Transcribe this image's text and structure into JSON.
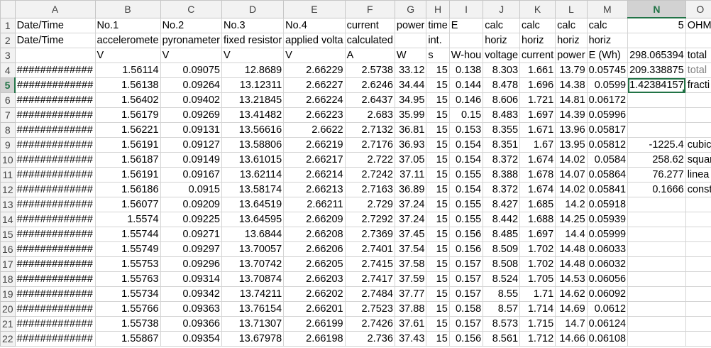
{
  "columns": [
    "A",
    "B",
    "C",
    "D",
    "E",
    "F",
    "G",
    "H",
    "I",
    "J",
    "K",
    "L",
    "M",
    "N",
    "O"
  ],
  "selected_col": "N",
  "selected_row": 5,
  "rows": [
    {
      "r": "1",
      "cells": [
        [
          "Date/Time",
          "t"
        ],
        [
          "No.1",
          "t"
        ],
        [
          "No.2",
          "t"
        ],
        [
          "No.3",
          "t"
        ],
        [
          "No.4",
          "t"
        ],
        [
          "current",
          "t"
        ],
        [
          "power",
          "t"
        ],
        [
          "time",
          "t"
        ],
        [
          "E",
          "t"
        ],
        [
          "calc",
          "t"
        ],
        [
          "calc",
          "t"
        ],
        [
          "calc",
          "t"
        ],
        [
          "calc",
          "t"
        ],
        [
          "5",
          "n"
        ],
        [
          "OHM",
          "t"
        ]
      ]
    },
    {
      "r": "2",
      "cells": [
        [
          "Date/Time",
          "t"
        ],
        [
          "acceleromete",
          "t"
        ],
        [
          "pyronameter",
          "t"
        ],
        [
          "fixed resistor",
          "t"
        ],
        [
          "applied volta",
          "t"
        ],
        [
          "calculated",
          "t"
        ],
        [
          "",
          "t"
        ],
        [
          "int.",
          "t"
        ],
        [
          "",
          "t"
        ],
        [
          "horiz",
          "t"
        ],
        [
          "horiz",
          "t"
        ],
        [
          "horiz",
          "t"
        ],
        [
          "horiz",
          "t"
        ],
        [
          "",
          "t"
        ],
        [
          "",
          "t"
        ]
      ]
    },
    {
      "r": "3",
      "cells": [
        [
          "",
          "t"
        ],
        [
          "V",
          "t"
        ],
        [
          "V",
          "t"
        ],
        [
          "V",
          "t"
        ],
        [
          "V",
          "t"
        ],
        [
          "A",
          "t"
        ],
        [
          "W",
          "t"
        ],
        [
          "s",
          "t"
        ],
        [
          "W-hou",
          "t"
        ],
        [
          "voltage",
          "t"
        ],
        [
          "current",
          "t"
        ],
        [
          "power",
          "t"
        ],
        [
          "E (Wh)",
          "t"
        ],
        [
          "298.065394",
          "n"
        ],
        [
          "total",
          "t"
        ]
      ]
    },
    {
      "r": "4",
      "cells": [
        [
          "#############",
          "h"
        ],
        [
          "1.56114",
          "n"
        ],
        [
          "0.09075",
          "n"
        ],
        [
          "12.8689",
          "n"
        ],
        [
          "2.66229",
          "n"
        ],
        [
          "2.5738",
          "n"
        ],
        [
          "33.12",
          "n"
        ],
        [
          "15",
          "n"
        ],
        [
          "0.138",
          "n"
        ],
        [
          "8.303",
          "n"
        ],
        [
          "1.661",
          "n"
        ],
        [
          "13.79",
          "n"
        ],
        [
          "0.05745",
          "n"
        ],
        [
          "209.338875",
          "n"
        ],
        [
          "total",
          "g"
        ]
      ]
    },
    {
      "r": "5",
      "cells": [
        [
          "#############",
          "h"
        ],
        [
          "1.56138",
          "n"
        ],
        [
          "0.09264",
          "n"
        ],
        [
          "13.12311",
          "n"
        ],
        [
          "2.66227",
          "n"
        ],
        [
          "2.6246",
          "n"
        ],
        [
          "34.44",
          "n"
        ],
        [
          "15",
          "n"
        ],
        [
          "0.144",
          "n"
        ],
        [
          "8.478",
          "n"
        ],
        [
          "1.696",
          "n"
        ],
        [
          "14.38",
          "n"
        ],
        [
          "0.0599",
          "n"
        ],
        [
          "1.42384157",
          "n"
        ],
        [
          "fracti",
          "t"
        ]
      ]
    },
    {
      "r": "6",
      "cells": [
        [
          "#############",
          "h"
        ],
        [
          "1.56402",
          "n"
        ],
        [
          "0.09402",
          "n"
        ],
        [
          "13.21845",
          "n"
        ],
        [
          "2.66224",
          "n"
        ],
        [
          "2.6437",
          "n"
        ],
        [
          "34.95",
          "n"
        ],
        [
          "15",
          "n"
        ],
        [
          "0.146",
          "n"
        ],
        [
          "8.606",
          "n"
        ],
        [
          "1.721",
          "n"
        ],
        [
          "14.81",
          "n"
        ],
        [
          "0.06172",
          "n"
        ],
        [
          "",
          "t"
        ],
        [
          "",
          "t"
        ]
      ]
    },
    {
      "r": "7",
      "cells": [
        [
          "#############",
          "h"
        ],
        [
          "1.56179",
          "n"
        ],
        [
          "0.09269",
          "n"
        ],
        [
          "13.41482",
          "n"
        ],
        [
          "2.66223",
          "n"
        ],
        [
          "2.683",
          "n"
        ],
        [
          "35.99",
          "n"
        ],
        [
          "15",
          "n"
        ],
        [
          "0.15",
          "n"
        ],
        [
          "8.483",
          "n"
        ],
        [
          "1.697",
          "n"
        ],
        [
          "14.39",
          "n"
        ],
        [
          "0.05996",
          "n"
        ],
        [
          "",
          "t"
        ],
        [
          "",
          "t"
        ]
      ]
    },
    {
      "r": "8",
      "cells": [
        [
          "#############",
          "h"
        ],
        [
          "1.56221",
          "n"
        ],
        [
          "0.09131",
          "n"
        ],
        [
          "13.56616",
          "n"
        ],
        [
          "2.6622",
          "n"
        ],
        [
          "2.7132",
          "n"
        ],
        [
          "36.81",
          "n"
        ],
        [
          "15",
          "n"
        ],
        [
          "0.153",
          "n"
        ],
        [
          "8.355",
          "n"
        ],
        [
          "1.671",
          "n"
        ],
        [
          "13.96",
          "n"
        ],
        [
          "0.05817",
          "n"
        ],
        [
          "",
          "t"
        ],
        [
          "",
          "t"
        ]
      ]
    },
    {
      "r": "9",
      "cells": [
        [
          "#############",
          "h"
        ],
        [
          "1.56191",
          "n"
        ],
        [
          "0.09127",
          "n"
        ],
        [
          "13.58806",
          "n"
        ],
        [
          "2.66219",
          "n"
        ],
        [
          "2.7176",
          "n"
        ],
        [
          "36.93",
          "n"
        ],
        [
          "15",
          "n"
        ],
        [
          "0.154",
          "n"
        ],
        [
          "8.351",
          "n"
        ],
        [
          "1.67",
          "n"
        ],
        [
          "13.95",
          "n"
        ],
        [
          "0.05812",
          "n"
        ],
        [
          "-1225.4",
          "n"
        ],
        [
          "cubic",
          "t"
        ]
      ]
    },
    {
      "r": "10",
      "cells": [
        [
          "#############",
          "h"
        ],
        [
          "1.56187",
          "n"
        ],
        [
          "0.09149",
          "n"
        ],
        [
          "13.61015",
          "n"
        ],
        [
          "2.66217",
          "n"
        ],
        [
          "2.722",
          "n"
        ],
        [
          "37.05",
          "n"
        ],
        [
          "15",
          "n"
        ],
        [
          "0.154",
          "n"
        ],
        [
          "8.372",
          "n"
        ],
        [
          "1.674",
          "n"
        ],
        [
          "14.02",
          "n"
        ],
        [
          "0.0584",
          "n"
        ],
        [
          "258.62",
          "n"
        ],
        [
          "squar",
          "t"
        ]
      ]
    },
    {
      "r": "11",
      "cells": [
        [
          "#############",
          "h"
        ],
        [
          "1.56191",
          "n"
        ],
        [
          "0.09167",
          "n"
        ],
        [
          "13.62114",
          "n"
        ],
        [
          "2.66214",
          "n"
        ],
        [
          "2.7242",
          "n"
        ],
        [
          "37.11",
          "n"
        ],
        [
          "15",
          "n"
        ],
        [
          "0.155",
          "n"
        ],
        [
          "8.388",
          "n"
        ],
        [
          "1.678",
          "n"
        ],
        [
          "14.07",
          "n"
        ],
        [
          "0.05864",
          "n"
        ],
        [
          "76.277",
          "n"
        ],
        [
          "linea",
          "t"
        ]
      ]
    },
    {
      "r": "12",
      "cells": [
        [
          "#############",
          "h"
        ],
        [
          "1.56186",
          "n"
        ],
        [
          "0.0915",
          "n"
        ],
        [
          "13.58174",
          "n"
        ],
        [
          "2.66213",
          "n"
        ],
        [
          "2.7163",
          "n"
        ],
        [
          "36.89",
          "n"
        ],
        [
          "15",
          "n"
        ],
        [
          "0.154",
          "n"
        ],
        [
          "8.372",
          "n"
        ],
        [
          "1.674",
          "n"
        ],
        [
          "14.02",
          "n"
        ],
        [
          "0.05841",
          "n"
        ],
        [
          "0.1666",
          "n"
        ],
        [
          "const",
          "t"
        ]
      ]
    },
    {
      "r": "13",
      "cells": [
        [
          "#############",
          "h"
        ],
        [
          "1.56077",
          "n"
        ],
        [
          "0.09209",
          "n"
        ],
        [
          "13.64519",
          "n"
        ],
        [
          "2.66211",
          "n"
        ],
        [
          "2.729",
          "n"
        ],
        [
          "37.24",
          "n"
        ],
        [
          "15",
          "n"
        ],
        [
          "0.155",
          "n"
        ],
        [
          "8.427",
          "n"
        ],
        [
          "1.685",
          "n"
        ],
        [
          "14.2",
          "n"
        ],
        [
          "0.05918",
          "n"
        ],
        [
          "",
          "t"
        ],
        [
          "",
          "t"
        ]
      ]
    },
    {
      "r": "14",
      "cells": [
        [
          "#############",
          "h"
        ],
        [
          "1.5574",
          "n"
        ],
        [
          "0.09225",
          "n"
        ],
        [
          "13.64595",
          "n"
        ],
        [
          "2.66209",
          "n"
        ],
        [
          "2.7292",
          "n"
        ],
        [
          "37.24",
          "n"
        ],
        [
          "15",
          "n"
        ],
        [
          "0.155",
          "n"
        ],
        [
          "8.442",
          "n"
        ],
        [
          "1.688",
          "n"
        ],
        [
          "14.25",
          "n"
        ],
        [
          "0.05939",
          "n"
        ],
        [
          "",
          "t"
        ],
        [
          "",
          "t"
        ]
      ]
    },
    {
      "r": "15",
      "cells": [
        [
          "#############",
          "h"
        ],
        [
          "1.55744",
          "n"
        ],
        [
          "0.09271",
          "n"
        ],
        [
          "13.6844",
          "n"
        ],
        [
          "2.66208",
          "n"
        ],
        [
          "2.7369",
          "n"
        ],
        [
          "37.45",
          "n"
        ],
        [
          "15",
          "n"
        ],
        [
          "0.156",
          "n"
        ],
        [
          "8.485",
          "n"
        ],
        [
          "1.697",
          "n"
        ],
        [
          "14.4",
          "n"
        ],
        [
          "0.05999",
          "n"
        ],
        [
          "",
          "t"
        ],
        [
          "",
          "t"
        ]
      ]
    },
    {
      "r": "16",
      "cells": [
        [
          "#############",
          "h"
        ],
        [
          "1.55749",
          "n"
        ],
        [
          "0.09297",
          "n"
        ],
        [
          "13.70057",
          "n"
        ],
        [
          "2.66206",
          "n"
        ],
        [
          "2.7401",
          "n"
        ],
        [
          "37.54",
          "n"
        ],
        [
          "15",
          "n"
        ],
        [
          "0.156",
          "n"
        ],
        [
          "8.509",
          "n"
        ],
        [
          "1.702",
          "n"
        ],
        [
          "14.48",
          "n"
        ],
        [
          "0.06033",
          "n"
        ],
        [
          "",
          "t"
        ],
        [
          "",
          "t"
        ]
      ]
    },
    {
      "r": "17",
      "cells": [
        [
          "#############",
          "h"
        ],
        [
          "1.55753",
          "n"
        ],
        [
          "0.09296",
          "n"
        ],
        [
          "13.70742",
          "n"
        ],
        [
          "2.66205",
          "n"
        ],
        [
          "2.7415",
          "n"
        ],
        [
          "37.58",
          "n"
        ],
        [
          "15",
          "n"
        ],
        [
          "0.157",
          "n"
        ],
        [
          "8.508",
          "n"
        ],
        [
          "1.702",
          "n"
        ],
        [
          "14.48",
          "n"
        ],
        [
          "0.06032",
          "n"
        ],
        [
          "",
          "t"
        ],
        [
          "",
          "t"
        ]
      ]
    },
    {
      "r": "18",
      "cells": [
        [
          "#############",
          "h"
        ],
        [
          "1.55763",
          "n"
        ],
        [
          "0.09314",
          "n"
        ],
        [
          "13.70874",
          "n"
        ],
        [
          "2.66203",
          "n"
        ],
        [
          "2.7417",
          "n"
        ],
        [
          "37.59",
          "n"
        ],
        [
          "15",
          "n"
        ],
        [
          "0.157",
          "n"
        ],
        [
          "8.524",
          "n"
        ],
        [
          "1.705",
          "n"
        ],
        [
          "14.53",
          "n"
        ],
        [
          "0.06056",
          "n"
        ],
        [
          "",
          "t"
        ],
        [
          "",
          "t"
        ]
      ]
    },
    {
      "r": "19",
      "cells": [
        [
          "#############",
          "h"
        ],
        [
          "1.55734",
          "n"
        ],
        [
          "0.09342",
          "n"
        ],
        [
          "13.74211",
          "n"
        ],
        [
          "2.66202",
          "n"
        ],
        [
          "2.7484",
          "n"
        ],
        [
          "37.77",
          "n"
        ],
        [
          "15",
          "n"
        ],
        [
          "0.157",
          "n"
        ],
        [
          "8.55",
          "n"
        ],
        [
          "1.71",
          "n"
        ],
        [
          "14.62",
          "n"
        ],
        [
          "0.06092",
          "n"
        ],
        [
          "",
          "t"
        ],
        [
          "",
          "t"
        ]
      ]
    },
    {
      "r": "20",
      "cells": [
        [
          "#############",
          "h"
        ],
        [
          "1.55766",
          "n"
        ],
        [
          "0.09363",
          "n"
        ],
        [
          "13.76154",
          "n"
        ],
        [
          "2.66201",
          "n"
        ],
        [
          "2.7523",
          "n"
        ],
        [
          "37.88",
          "n"
        ],
        [
          "15",
          "n"
        ],
        [
          "0.158",
          "n"
        ],
        [
          "8.57",
          "n"
        ],
        [
          "1.714",
          "n"
        ],
        [
          "14.69",
          "n"
        ],
        [
          "0.0612",
          "n"
        ],
        [
          "",
          "t"
        ],
        [
          "",
          "t"
        ]
      ]
    },
    {
      "r": "21",
      "cells": [
        [
          "#############",
          "h"
        ],
        [
          "1.55738",
          "n"
        ],
        [
          "0.09366",
          "n"
        ],
        [
          "13.71307",
          "n"
        ],
        [
          "2.66199",
          "n"
        ],
        [
          "2.7426",
          "n"
        ],
        [
          "37.61",
          "n"
        ],
        [
          "15",
          "n"
        ],
        [
          "0.157",
          "n"
        ],
        [
          "8.573",
          "n"
        ],
        [
          "1.715",
          "n"
        ],
        [
          "14.7",
          "n"
        ],
        [
          "0.06124",
          "n"
        ],
        [
          "",
          "t"
        ],
        [
          "",
          "t"
        ]
      ]
    },
    {
      "r": "22",
      "cells": [
        [
          "#############",
          "h"
        ],
        [
          "1.55867",
          "n"
        ],
        [
          "0.09354",
          "n"
        ],
        [
          "13.67978",
          "n"
        ],
        [
          "2.66198",
          "n"
        ],
        [
          "2.736",
          "n"
        ],
        [
          "37.43",
          "n"
        ],
        [
          "15",
          "n"
        ],
        [
          "0.156",
          "n"
        ],
        [
          "8.561",
          "n"
        ],
        [
          "1.712",
          "n"
        ],
        [
          "14.66",
          "n"
        ],
        [
          "0.06108",
          "n"
        ],
        [
          "",
          "t"
        ],
        [
          "",
          "t"
        ]
      ]
    }
  ]
}
